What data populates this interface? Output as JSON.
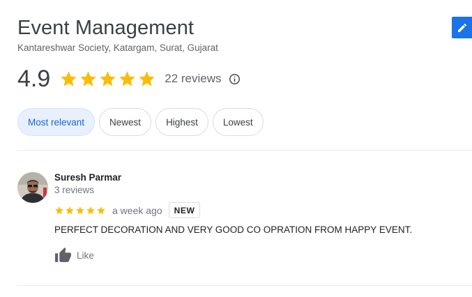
{
  "business": {
    "name": "Event Management",
    "address": "Kantareshwar Society, Katargam, Surat, Gujarat",
    "rating": "4.9",
    "stars": 5,
    "reviews_count": "22 reviews"
  },
  "sort_chips": [
    {
      "label": "Most relevant",
      "selected": true
    },
    {
      "label": "Newest",
      "selected": false
    },
    {
      "label": "Highest",
      "selected": false
    },
    {
      "label": "Lowest",
      "selected": false
    }
  ],
  "reviews": [
    {
      "name": "Suresh Parmar",
      "review_count": "3 reviews",
      "stars": 5,
      "time": "a week ago",
      "badge": "NEW",
      "text": "PERFECT DECORATION AND VERY GOOD CO OPRATION FROM HAPPY EVENT.",
      "like_label": "Like"
    }
  ],
  "colors": {
    "star": "#fbbc04",
    "accent": "#1a73e8",
    "chip_selected_bg": "#e8f0fe",
    "chip_selected_text": "#1967d2"
  },
  "icons": {
    "edit": "pencil-icon",
    "info": "info-icon",
    "like": "thumbs-up-icon",
    "star": "star-icon"
  }
}
